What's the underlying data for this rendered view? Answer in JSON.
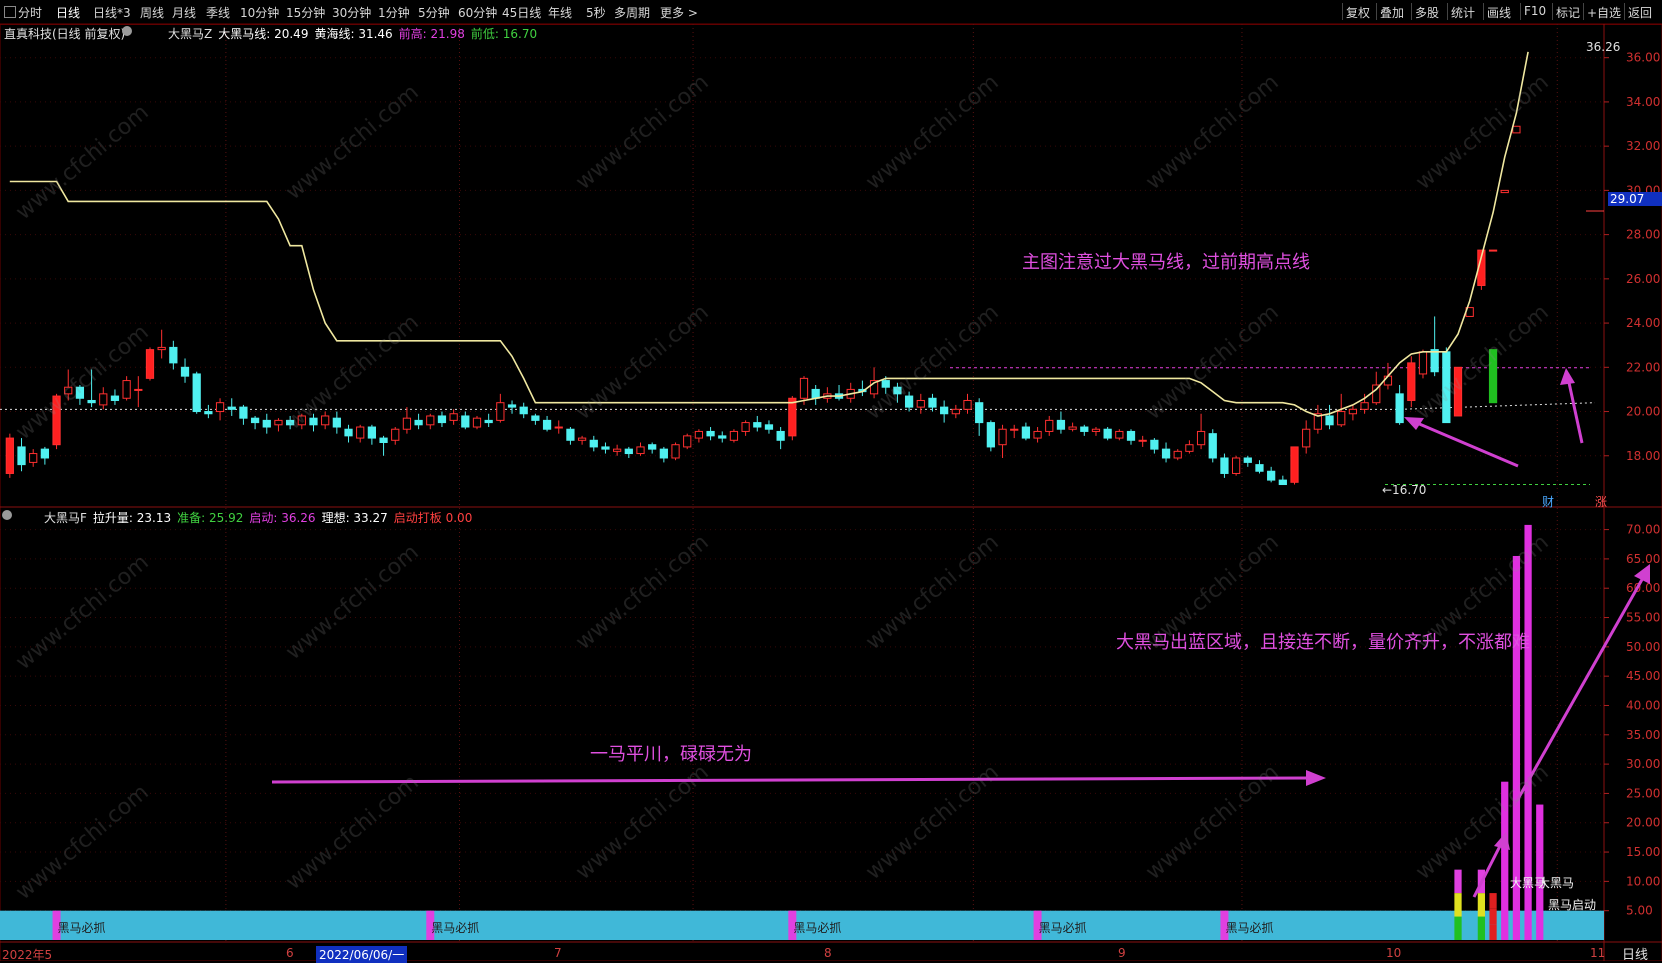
{
  "toolbar": {
    "left": [
      "分时",
      "日线",
      "日线*3",
      "周线",
      "月线",
      "季线",
      "10分钟",
      "15分钟",
      "30分钟",
      "1分钟",
      "5分钟",
      "60分钟",
      "45日线",
      "年线",
      "5秒",
      "多周期",
      "更多 >"
    ],
    "active": "日线",
    "right": [
      "复权",
      "叠加",
      "多股",
      "统计",
      "画线",
      "F10",
      "标记",
      "+自选",
      "返回"
    ]
  },
  "main_header": {
    "stock": "直真科技(日线 前复权)",
    "indicator": "大黑马Z",
    "items": [
      {
        "label": "大黑马线:",
        "value": "20.49",
        "color": "#ffffff"
      },
      {
        "label": "黄海线:",
        "value": "31.46",
        "color": "#ffffff"
      },
      {
        "label": "前高:",
        "value": "21.98",
        "color": "#e040e0"
      },
      {
        "label": "前低:",
        "value": "16.70",
        "color": "#40d040"
      }
    ]
  },
  "sub_header": {
    "indicator": "大黑马F",
    "items": [
      {
        "label": "拉升量:",
        "value": "23.13",
        "color": "#ffffff"
      },
      {
        "label": "准备:",
        "value": "25.92",
        "color": "#40d040"
      },
      {
        "label": "启动:",
        "value": "36.26",
        "color": "#e040e0"
      },
      {
        "label": "理想:",
        "value": "33.27",
        "color": "#ffffff"
      },
      {
        "label": "启动打板",
        "value": "0.00",
        "color": "#ff4040"
      }
    ]
  },
  "annotations": {
    "main_note": "主图注意过大黑马线，过前期高点线",
    "sub_note_right": "大黑马出蓝区域，且接连不断，量价齐升，不涨都难",
    "sub_note_mid": "一马平川，碌碌无为"
  },
  "price_markers": {
    "high_label": "36.26",
    "low_label": "←16.70",
    "current_price": "29.07",
    "finance_tag": "财",
    "rise_tag": "涨"
  },
  "signal_labels": {
    "band": "黑马必抓",
    "big": "大黑马",
    "start": "黑马启动"
  },
  "x_axis": [
    "2022年5",
    "6",
    "2022/06/06/一",
    "7",
    "8",
    "9",
    "10",
    "11"
  ],
  "period_label": "日线",
  "watermark": "www.cfchi.com",
  "chart_data": [
    {
      "type": "candlestick",
      "title": "大黑马Z",
      "y_ticks": [
        "18.00",
        "20.00",
        "22.00",
        "24.00",
        "26.00",
        "28.00",
        "30.00",
        "32.00",
        "34.00",
        "36.00"
      ],
      "ylim": [
        16.0,
        36.8
      ],
      "prev_high": 21.98,
      "prev_low": 16.7,
      "dotted_level": 20.1,
      "candles": [
        [
          17.2,
          18.8,
          19.0,
          17.0
        ],
        [
          18.4,
          17.6,
          18.8,
          17.3
        ],
        [
          17.7,
          18.1,
          18.3,
          17.5
        ],
        [
          18.3,
          17.9,
          18.4,
          17.6
        ],
        [
          18.5,
          20.7,
          20.8,
          18.3
        ],
        [
          20.8,
          21.1,
          21.9,
          20.5
        ],
        [
          21.1,
          20.6,
          21.2,
          20.3
        ],
        [
          20.5,
          20.4,
          21.9,
          20.2
        ],
        [
          20.3,
          20.8,
          21.1,
          20.1
        ],
        [
          20.7,
          20.5,
          21.0,
          20.3
        ],
        [
          20.6,
          21.4,
          21.6,
          20.5
        ],
        [
          21.0,
          21.0,
          21.6,
          20.2
        ],
        [
          21.5,
          22.8,
          22.9,
          21.4
        ],
        [
          22.8,
          22.9,
          23.7,
          22.4
        ],
        [
          22.9,
          22.2,
          23.2,
          21.9
        ],
        [
          22.0,
          21.6,
          22.4,
          21.3
        ],
        [
          21.7,
          20.0,
          21.8,
          19.9
        ],
        [
          20.0,
          19.9,
          20.3,
          19.7
        ],
        [
          20.0,
          20.4,
          20.6,
          19.6
        ],
        [
          20.2,
          20.1,
          20.6,
          19.8
        ],
        [
          20.2,
          19.7,
          20.3,
          19.4
        ],
        [
          19.7,
          19.5,
          19.8,
          19.2
        ],
        [
          19.6,
          19.3,
          19.9,
          19.0
        ],
        [
          19.4,
          19.6,
          19.7,
          19.1
        ],
        [
          19.6,
          19.4,
          19.8,
          19.2
        ],
        [
          19.4,
          19.8,
          19.9,
          19.2
        ],
        [
          19.7,
          19.4,
          19.9,
          19.1
        ],
        [
          19.4,
          19.8,
          20.0,
          19.2
        ],
        [
          19.7,
          19.3,
          20.0,
          19.0
        ],
        [
          19.2,
          18.9,
          19.4,
          18.6
        ],
        [
          18.8,
          19.3,
          19.4,
          18.6
        ],
        [
          19.3,
          18.8,
          19.4,
          18.5
        ],
        [
          18.8,
          18.6,
          18.9,
          18.0
        ],
        [
          18.7,
          19.2,
          19.3,
          18.5
        ],
        [
          19.2,
          19.7,
          20.2,
          19.0
        ],
        [
          19.6,
          19.4,
          19.9,
          19.2
        ],
        [
          19.4,
          19.8,
          19.9,
          19.2
        ],
        [
          19.8,
          19.5,
          20.0,
          19.3
        ],
        [
          19.6,
          19.9,
          20.1,
          19.4
        ],
        [
          19.8,
          19.3,
          20.0,
          19.2
        ],
        [
          19.3,
          19.7,
          19.8,
          19.2
        ],
        [
          19.6,
          19.5,
          19.9,
          19.3
        ],
        [
          19.6,
          20.4,
          20.8,
          19.5
        ],
        [
          20.3,
          20.2,
          20.5,
          19.9
        ],
        [
          20.2,
          19.9,
          20.4,
          19.7
        ],
        [
          19.8,
          19.6,
          19.9,
          19.4
        ],
        [
          19.6,
          19.2,
          19.8,
          19.1
        ],
        [
          19.3,
          19.3,
          19.6,
          19.0
        ],
        [
          19.2,
          18.7,
          19.3,
          18.5
        ],
        [
          18.7,
          18.8,
          18.9,
          18.5
        ],
        [
          18.7,
          18.4,
          18.9,
          18.2
        ],
        [
          18.4,
          18.3,
          18.6,
          18.1
        ],
        [
          18.2,
          18.3,
          18.5,
          18.0
        ],
        [
          18.3,
          18.1,
          18.4,
          17.9
        ],
        [
          18.1,
          18.4,
          18.6,
          18.0
        ],
        [
          18.5,
          18.3,
          18.6,
          18.1
        ],
        [
          18.3,
          17.9,
          18.4,
          17.7
        ],
        [
          17.9,
          18.5,
          18.6,
          17.8
        ],
        [
          18.4,
          18.9,
          19.0,
          18.3
        ],
        [
          18.8,
          19.1,
          19.2,
          18.6
        ],
        [
          19.1,
          18.9,
          19.3,
          18.7
        ],
        [
          18.9,
          18.8,
          19.1,
          18.6
        ],
        [
          18.7,
          19.1,
          19.2,
          18.6
        ],
        [
          19.1,
          19.5,
          19.6,
          18.9
        ],
        [
          19.5,
          19.3,
          19.8,
          19.1
        ],
        [
          19.4,
          19.2,
          19.6,
          19.0
        ],
        [
          19.1,
          18.7,
          19.3,
          18.3
        ],
        [
          18.9,
          20.6,
          20.7,
          18.7
        ],
        [
          20.6,
          21.5,
          21.6,
          20.3
        ],
        [
          21.0,
          20.6,
          21.2,
          20.3
        ],
        [
          20.6,
          20.8,
          21.1,
          20.4
        ],
        [
          20.8,
          20.6,
          21.2,
          20.5
        ],
        [
          20.6,
          21.0,
          21.3,
          20.4
        ],
        [
          21.0,
          20.9,
          21.4,
          20.7
        ],
        [
          20.8,
          21.4,
          22.0,
          20.6
        ],
        [
          21.4,
          21.1,
          21.6,
          20.8
        ],
        [
          21.1,
          20.8,
          21.3,
          20.4
        ],
        [
          20.7,
          20.2,
          20.9,
          20.0
        ],
        [
          20.2,
          20.5,
          20.8,
          19.9
        ],
        [
          20.6,
          20.2,
          20.8,
          20.0
        ],
        [
          20.2,
          19.9,
          20.5,
          19.5
        ],
        [
          19.9,
          20.1,
          20.3,
          19.7
        ],
        [
          20.1,
          20.5,
          20.8,
          19.9
        ],
        [
          20.4,
          19.5,
          20.6,
          18.9
        ],
        [
          19.5,
          18.4,
          19.6,
          18.2
        ],
        [
          18.5,
          19.2,
          19.4,
          17.9
        ],
        [
          19.2,
          19.2,
          19.4,
          18.8
        ],
        [
          19.3,
          18.8,
          19.5,
          18.7
        ],
        [
          18.8,
          19.1,
          19.3,
          18.6
        ],
        [
          19.1,
          19.6,
          19.8,
          18.9
        ],
        [
          19.6,
          19.2,
          20.0,
          19.0
        ],
        [
          19.2,
          19.3,
          19.5,
          19.1
        ],
        [
          19.3,
          19.1,
          19.4,
          18.9
        ],
        [
          19.1,
          19.2,
          19.3,
          18.9
        ],
        [
          19.2,
          18.8,
          19.3,
          18.7
        ],
        [
          18.8,
          19.1,
          19.2,
          18.7
        ],
        [
          19.1,
          18.7,
          19.2,
          18.5
        ],
        [
          18.7,
          18.7,
          18.9,
          18.4
        ],
        [
          18.7,
          18.3,
          18.8,
          18.1
        ],
        [
          18.3,
          17.9,
          18.6,
          17.7
        ],
        [
          17.9,
          18.2,
          18.3,
          17.8
        ],
        [
          18.2,
          18.5,
          18.7,
          18.1
        ],
        [
          18.5,
          19.1,
          19.9,
          18.3
        ],
        [
          19.0,
          17.9,
          19.2,
          17.7
        ],
        [
          17.9,
          17.2,
          18.1,
          17.0
        ],
        [
          17.2,
          17.9,
          18.0,
          17.1
        ],
        [
          17.9,
          17.7,
          18.0,
          17.5
        ],
        [
          17.6,
          17.3,
          17.8,
          17.2
        ],
        [
          17.3,
          16.9,
          17.5,
          16.8
        ],
        [
          16.9,
          16.7,
          17.1,
          16.7
        ],
        [
          16.8,
          18.4,
          18.4,
          16.7
        ],
        [
          18.4,
          19.2,
          19.6,
          18.1
        ],
        [
          19.2,
          19.9,
          20.3,
          19.0
        ],
        [
          19.8,
          19.4,
          20.3,
          19.2
        ],
        [
          19.4,
          20.0,
          20.8,
          19.3
        ],
        [
          19.9,
          20.1,
          20.3,
          19.6
        ],
        [
          20.1,
          20.4,
          20.8,
          19.9
        ],
        [
          20.4,
          21.2,
          21.8,
          20.3
        ],
        [
          21.2,
          21.6,
          22.2,
          21.0
        ],
        [
          20.8,
          19.5,
          21.2,
          19.4
        ],
        [
          20.5,
          22.2,
          22.5,
          20.2
        ],
        [
          21.7,
          22.7,
          22.8,
          21.5
        ],
        [
          22.8,
          21.8,
          24.3,
          21.6
        ],
        [
          22.7,
          19.5,
          22.9,
          19.5
        ],
        [
          19.8,
          22.0,
          22.0,
          19.8
        ],
        [
          24.3,
          24.7,
          24.7,
          24.3
        ],
        [
          25.7,
          27.3,
          27.3,
          25.5
        ],
        [
          27.3,
          27.3,
          27.3,
          27.3
        ],
        [
          29.9,
          30.0,
          30.0,
          29.9
        ],
        [
          32.6,
          32.9,
          32.9,
          32.6
        ]
      ],
      "yellow_line": [
        30.4,
        30.4,
        30.4,
        30.4,
        30.4,
        29.5,
        29.5,
        29.5,
        29.5,
        29.5,
        29.5,
        29.5,
        29.5,
        29.5,
        29.5,
        29.5,
        29.5,
        29.5,
        29.5,
        29.5,
        29.5,
        29.5,
        29.5,
        28.7,
        27.5,
        27.5,
        25.5,
        24.0,
        23.2,
        23.2,
        23.2,
        23.2,
        23.2,
        23.2,
        23.2,
        23.2,
        23.2,
        23.2,
        23.2,
        23.2,
        23.2,
        23.2,
        23.2,
        22.5,
        21.5,
        20.4,
        20.4,
        20.4,
        20.4,
        20.4,
        20.4,
        20.4,
        20.4,
        20.4,
        20.4,
        20.4,
        20.4,
        20.4,
        20.4,
        20.4,
        20.4,
        20.4,
        20.4,
        20.4,
        20.4,
        20.4,
        20.4,
        20.4,
        20.5,
        20.6,
        20.7,
        20.7,
        20.8,
        20.9,
        21.3,
        21.5,
        21.5,
        21.5,
        21.5,
        21.5,
        21.5,
        21.5,
        21.5,
        21.5,
        21.5,
        21.5,
        21.5,
        21.5,
        21.5,
        21.5,
        21.5,
        21.5,
        21.5,
        21.5,
        21.5,
        21.5,
        21.5,
        21.5,
        21.5,
        21.5,
        21.5,
        21.5,
        21.3,
        20.9,
        20.5,
        20.4,
        20.4,
        20.4,
        20.4,
        20.4,
        20.3,
        20.0,
        19.8,
        19.9,
        20.1,
        20.3,
        20.6,
        21.0,
        21.6,
        22.2,
        22.6,
        22.7,
        22.7,
        22.7,
        23.5,
        25.0,
        27.0,
        29.0,
        31.5,
        33.5,
        36.26
      ]
    },
    {
      "type": "bar",
      "title": "大黑马F",
      "y_ticks": [
        "5.00",
        "10.00",
        "15.00",
        "20.00",
        "25.00",
        "30.00",
        "35.00",
        "40.00",
        "45.00",
        "50.00",
        "55.00",
        "60.00",
        "65.00",
        "70.00"
      ],
      "ylim": [
        0,
        73
      ],
      "band_top": 5.0,
      "magenta_bars": [
        {
          "index": 128,
          "value": 27.0
        },
        {
          "index": 129,
          "value": 65.5
        },
        {
          "index": 130,
          "value": 70.8
        },
        {
          "index": 131,
          "value": 23.1
        }
      ],
      "signal_bars": [
        {
          "index": 124,
          "value": 12.0,
          "low": "#20c020",
          "mid": "#e0e020",
          "top": "#e040e0"
        },
        {
          "index": 126,
          "value": 12.0,
          "low": "#20c020",
          "mid": "#e0e020",
          "top": "#e040e0"
        },
        {
          "index": 127,
          "value": 8.0,
          "low": "#e02020",
          "mid": "#e02020",
          "top": "#e02020"
        }
      ],
      "band_marker_indices": [
        4,
        36,
        67,
        88,
        104
      ]
    }
  ]
}
